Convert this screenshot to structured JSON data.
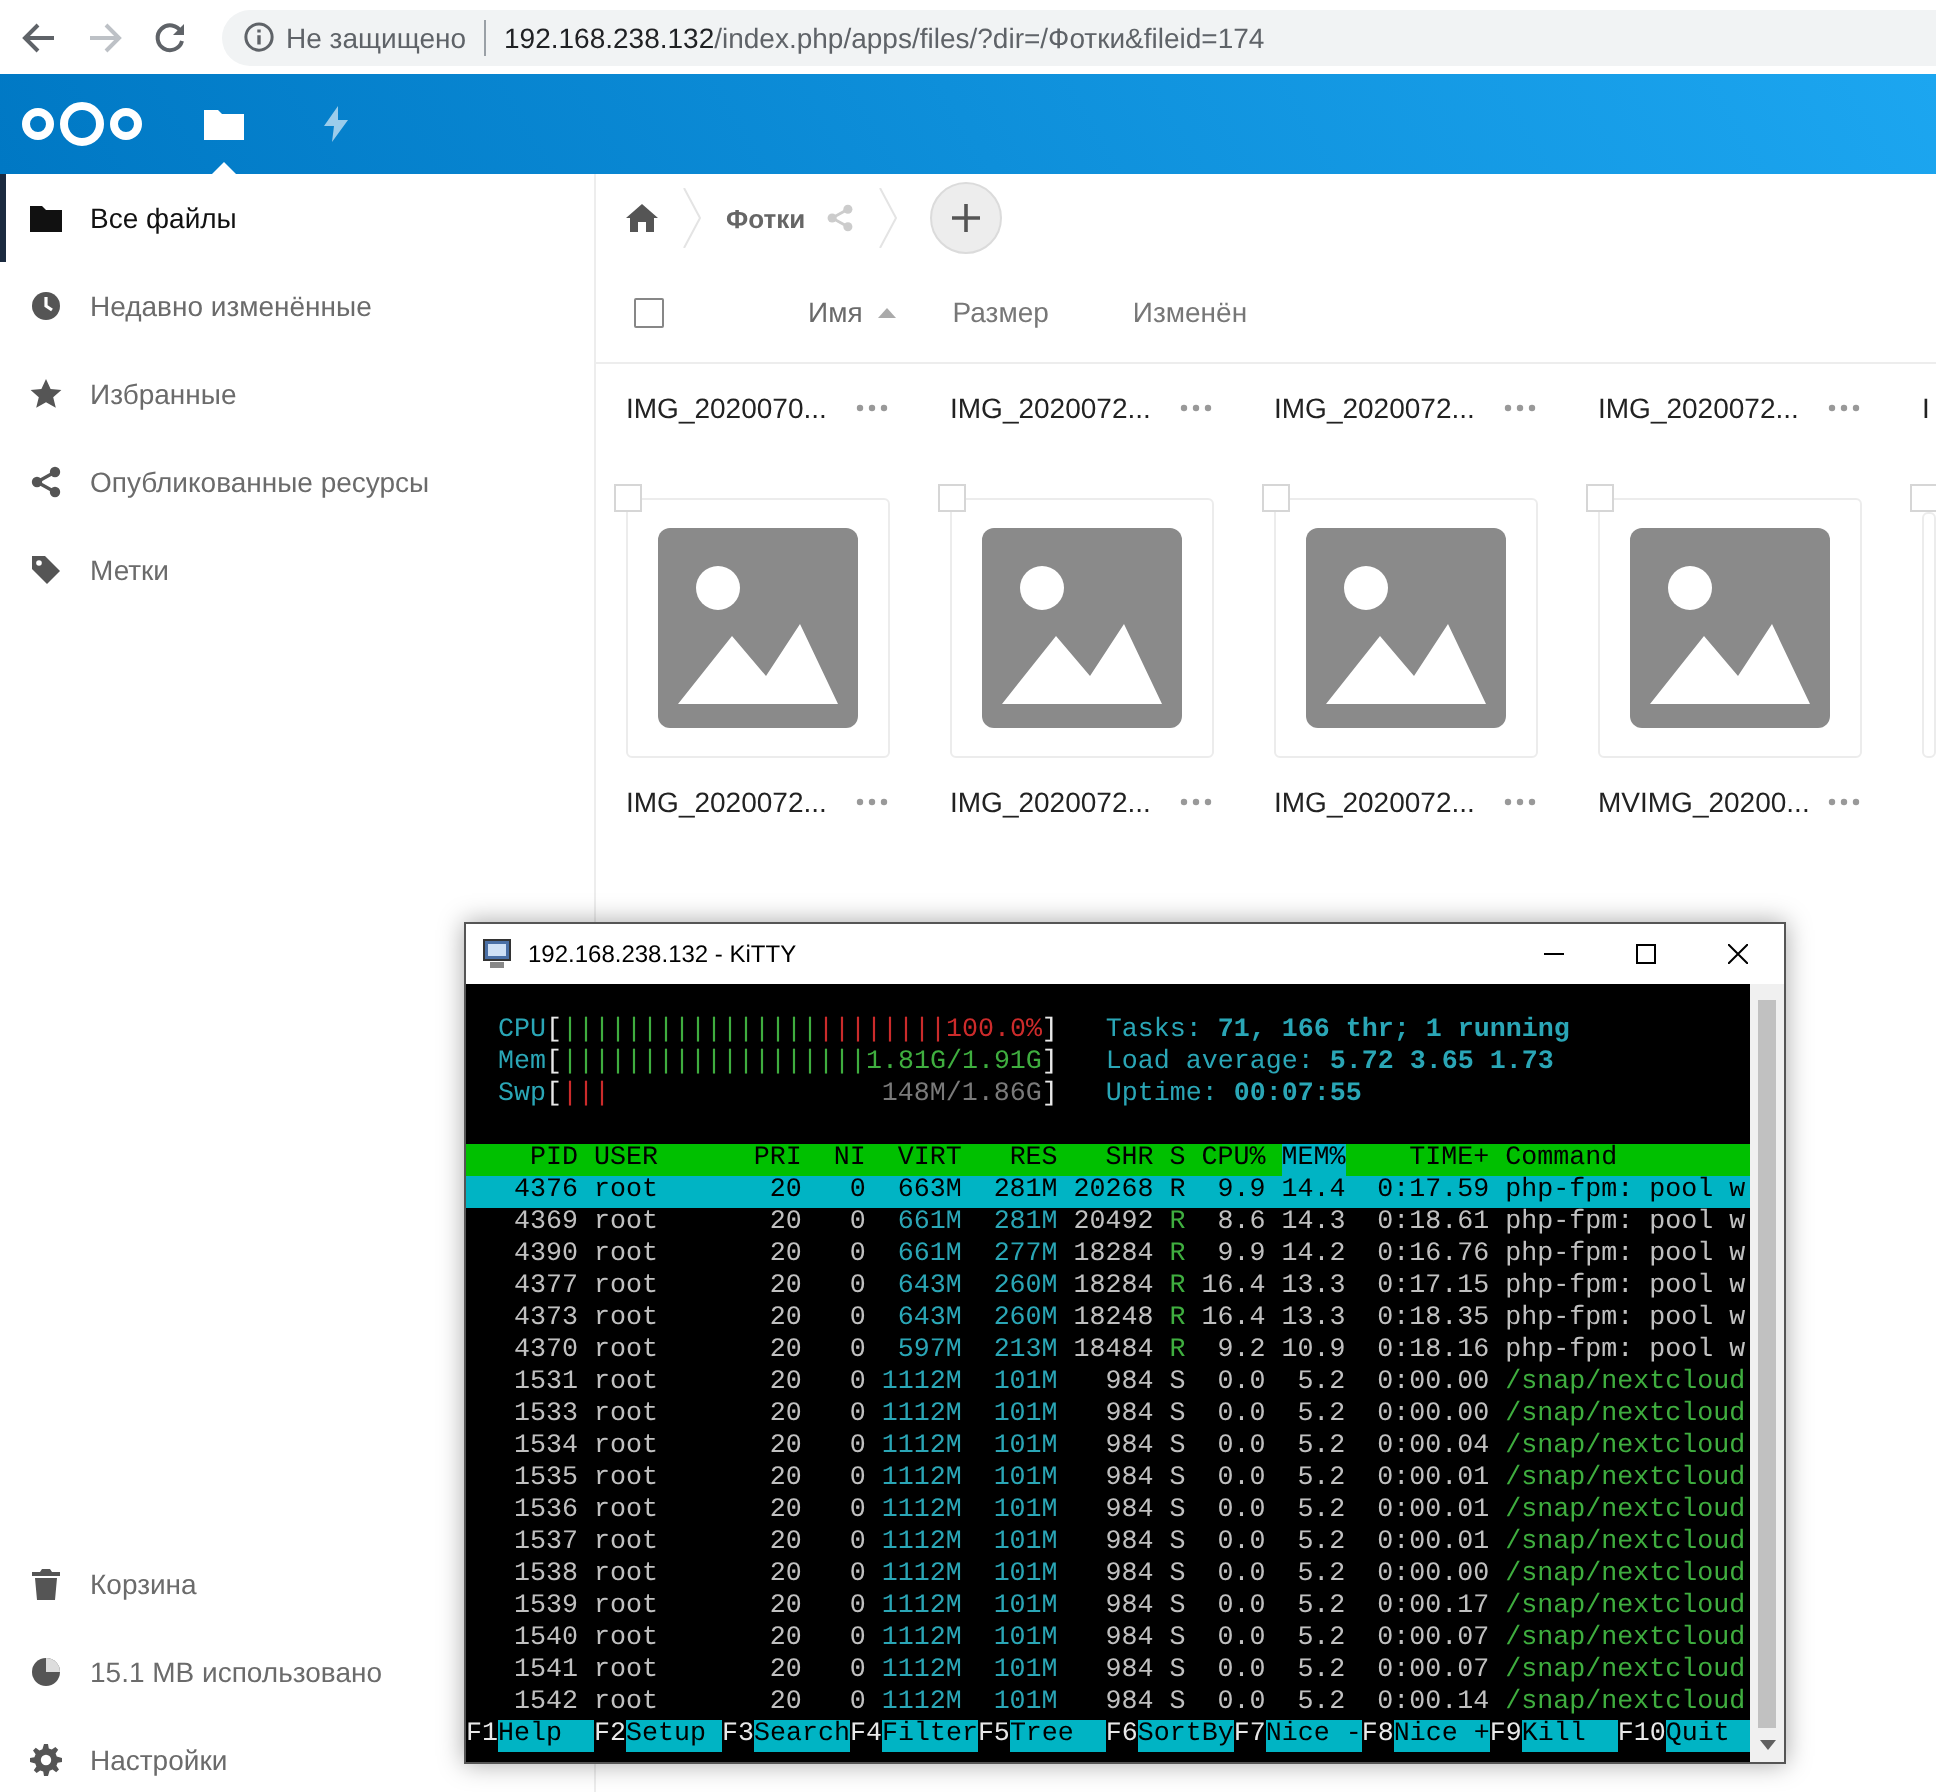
{
  "browser": {
    "forward_disabled": true,
    "security": "Не защищено",
    "url_host": "192.168.238.132",
    "url_path": "/index.php/apps/files/?dir=/Фотки&fileid=174"
  },
  "header": {
    "apps": [
      {
        "kind": "files",
        "selected": true
      },
      {
        "kind": "activity",
        "selected": false
      }
    ]
  },
  "sidebar": {
    "items": [
      {
        "kind": "folder",
        "label": "Все файлы",
        "selected": true
      },
      {
        "kind": "clock",
        "label": "Недавно изменённые",
        "selected": false
      },
      {
        "kind": "star",
        "label": "Избранные",
        "selected": false
      },
      {
        "kind": "share",
        "label": "Опубликованные ресурсы",
        "selected": false
      },
      {
        "kind": "tag",
        "label": "Метки",
        "selected": false
      }
    ],
    "footer": [
      {
        "kind": "trash",
        "label": "Корзина"
      },
      {
        "kind": "pie",
        "label": "15.1 MB использовано"
      },
      {
        "kind": "gear",
        "label": "Настройки"
      }
    ]
  },
  "breadcrumb": {
    "folder": "Фотки"
  },
  "select_all": {
    "checked": false
  },
  "columns": [
    {
      "label": "Имя",
      "sorted": true
    },
    {
      "label": "Размер",
      "sorted": false
    },
    {
      "label": "Изменён",
      "sorted": false
    }
  ],
  "grid": [
    {
      "kind": "names",
      "files": [
        {
          "name": "IMG_2020070..."
        },
        {
          "name": "IMG_2020072..."
        },
        {
          "name": "IMG_2020072..."
        },
        {
          "name": "IMG_2020072..."
        },
        {
          "name": "I"
        }
      ]
    },
    {
      "kind": "thumbnails",
      "files": [
        {
          "name": "IMG_2020072...",
          "checked": false
        },
        {
          "name": "IMG_2020072...",
          "checked": false
        },
        {
          "name": "IMG_2020072...",
          "checked": false
        },
        {
          "name": "MVIMG_20200...",
          "checked": false
        },
        {
          "checked": false
        }
      ]
    }
  ],
  "terminal": {
    "title": "192.168.238.132 - KiTTY",
    "meters": [
      {
        "label": "CPU",
        "open": "[",
        "bars": [
          {
            "text": "||||||||||||||||",
            "color": "#3fae3f"
          },
          {
            "text": "||||||||",
            "color": "#cc2b2b"
          }
        ],
        "value": {
          "text": "100.0%",
          "color": "#cc2b2b"
        },
        "close": "]"
      },
      {
        "label": "Mem",
        "open": "[",
        "bars": [
          {
            "text": "|||||||||||||||||||",
            "color": "#3fae3f"
          }
        ],
        "value": {
          "text": "1.81G/1.91G",
          "color": "#3fae3f"
        },
        "close": "]"
      },
      {
        "label": "Swp",
        "open": "[",
        "bars": [
          {
            "text": "|||",
            "color": "#cc2b2b"
          }
        ],
        "value": {
          "text": "148M/1.86G",
          "color": "#7a7a7a"
        },
        "close": "]"
      }
    ],
    "summary": [
      {
        "label": "Tasks:",
        "value": "71, 166 thr; 1 running"
      },
      {
        "label": "Load average:",
        "value": "5.72 3.65 1.73"
      },
      {
        "label": "Uptime:",
        "value": "00:07:55"
      }
    ],
    "columns": [
      {
        "label": "PID",
        "sorted": false
      },
      {
        "label": "USER",
        "sorted": false
      },
      {
        "label": "PRI",
        "sorted": false
      },
      {
        "label": "NI",
        "sorted": false
      },
      {
        "label": "VIRT",
        "sorted": false
      },
      {
        "label": "RES",
        "sorted": false
      },
      {
        "label": "SHR",
        "sorted": false
      },
      {
        "label": "S",
        "sorted": false
      },
      {
        "label": "CPU%",
        "sorted": false
      },
      {
        "label": "MEM%",
        "sorted": true
      },
      {
        "label": "TIME+",
        "sorted": false
      },
      {
        "label": "Command",
        "sorted": false
      }
    ],
    "processes": [
      {
        "pid": "4376",
        "user": "root",
        "pri": "20",
        "ni": "0",
        "virt": "663M",
        "res": "281M",
        "shr": "20268",
        "state": "R",
        "cpu": "9.9",
        "mem": "14.4",
        "time": "0:17.59",
        "command": "php-fpm: pool w",
        "running": true,
        "thread": false,
        "selected": true
      },
      {
        "pid": "4369",
        "user": "root",
        "pri": "20",
        "ni": "0",
        "virt": "661M",
        "res": "281M",
        "shr": "20492",
        "state": "R",
        "cpu": "8.6",
        "mem": "14.3",
        "time": "0:18.61",
        "command": "php-fpm: pool w",
        "running": true,
        "thread": false,
        "selected": false
      },
      {
        "pid": "4390",
        "user": "root",
        "pri": "20",
        "ni": "0",
        "virt": "661M",
        "res": "277M",
        "shr": "18284",
        "state": "R",
        "cpu": "9.9",
        "mem": "14.2",
        "time": "0:16.76",
        "command": "php-fpm: pool w",
        "running": true,
        "thread": false,
        "selected": false
      },
      {
        "pid": "4377",
        "user": "root",
        "pri": "20",
        "ni": "0",
        "virt": "643M",
        "res": "260M",
        "shr": "18284",
        "state": "R",
        "cpu": "16.4",
        "mem": "13.3",
        "time": "0:17.15",
        "command": "php-fpm: pool w",
        "running": true,
        "thread": false,
        "selected": false
      },
      {
        "pid": "4373",
        "user": "root",
        "pri": "20",
        "ni": "0",
        "virt": "643M",
        "res": "260M",
        "shr": "18248",
        "state": "R",
        "cpu": "16.4",
        "mem": "13.3",
        "time": "0:18.35",
        "command": "php-fpm: pool w",
        "running": true,
        "thread": false,
        "selected": false
      },
      {
        "pid": "4370",
        "user": "root",
        "pri": "20",
        "ni": "0",
        "virt": "597M",
        "res": "213M",
        "shr": "18484",
        "state": "R",
        "cpu": "9.2",
        "mem": "10.9",
        "time": "0:18.16",
        "command": "php-fpm: pool w",
        "running": true,
        "thread": false,
        "selected": false
      },
      {
        "pid": "1531",
        "user": "root",
        "pri": "20",
        "ni": "0",
        "virt": "1112M",
        "res": "101M",
        "shr": "984",
        "state": "S",
        "cpu": "0.0",
        "mem": "5.2",
        "time": "0:00.00",
        "command": "/snap/nextcloud",
        "running": false,
        "thread": true,
        "selected": false
      },
      {
        "pid": "1533",
        "user": "root",
        "pri": "20",
        "ni": "0",
        "virt": "1112M",
        "res": "101M",
        "shr": "984",
        "state": "S",
        "cpu": "0.0",
        "mem": "5.2",
        "time": "0:00.00",
        "command": "/snap/nextcloud",
        "running": false,
        "thread": true,
        "selected": false
      },
      {
        "pid": "1534",
        "user": "root",
        "pri": "20",
        "ni": "0",
        "virt": "1112M",
        "res": "101M",
        "shr": "984",
        "state": "S",
        "cpu": "0.0",
        "mem": "5.2",
        "time": "0:00.04",
        "command": "/snap/nextcloud",
        "running": false,
        "thread": true,
        "selected": false
      },
      {
        "pid": "1535",
        "user": "root",
        "pri": "20",
        "ni": "0",
        "virt": "1112M",
        "res": "101M",
        "shr": "984",
        "state": "S",
        "cpu": "0.0",
        "mem": "5.2",
        "time": "0:00.01",
        "command": "/snap/nextcloud",
        "running": false,
        "thread": true,
        "selected": false
      },
      {
        "pid": "1536",
        "user": "root",
        "pri": "20",
        "ni": "0",
        "virt": "1112M",
        "res": "101M",
        "shr": "984",
        "state": "S",
        "cpu": "0.0",
        "mem": "5.2",
        "time": "0:00.01",
        "command": "/snap/nextcloud",
        "running": false,
        "thread": true,
        "selected": false
      },
      {
        "pid": "1537",
        "user": "root",
        "pri": "20",
        "ni": "0",
        "virt": "1112M",
        "res": "101M",
        "shr": "984",
        "state": "S",
        "cpu": "0.0",
        "mem": "5.2",
        "time": "0:00.01",
        "command": "/snap/nextcloud",
        "running": false,
        "thread": true,
        "selected": false
      },
      {
        "pid": "1538",
        "user": "root",
        "pri": "20",
        "ni": "0",
        "virt": "1112M",
        "res": "101M",
        "shr": "984",
        "state": "S",
        "cpu": "0.0",
        "mem": "5.2",
        "time": "0:00.00",
        "command": "/snap/nextcloud",
        "running": false,
        "thread": true,
        "selected": false
      },
      {
        "pid": "1539",
        "user": "root",
        "pri": "20",
        "ni": "0",
        "virt": "1112M",
        "res": "101M",
        "shr": "984",
        "state": "S",
        "cpu": "0.0",
        "mem": "5.2",
        "time": "0:00.17",
        "command": "/snap/nextcloud",
        "running": false,
        "thread": true,
        "selected": false
      },
      {
        "pid": "1540",
        "user": "root",
        "pri": "20",
        "ni": "0",
        "virt": "1112M",
        "res": "101M",
        "shr": "984",
        "state": "S",
        "cpu": "0.0",
        "mem": "5.2",
        "time": "0:00.07",
        "command": "/snap/nextcloud",
        "running": false,
        "thread": true,
        "selected": false
      },
      {
        "pid": "1541",
        "user": "root",
        "pri": "20",
        "ni": "0",
        "virt": "1112M",
        "res": "101M",
        "shr": "984",
        "state": "S",
        "cpu": "0.0",
        "mem": "5.2",
        "time": "0:00.07",
        "command": "/snap/nextcloud",
        "running": false,
        "thread": true,
        "selected": false
      },
      {
        "pid": "1542",
        "user": "root",
        "pri": "20",
        "ni": "0",
        "virt": "1112M",
        "res": "101M",
        "shr": "984",
        "state": "S",
        "cpu": "0.0",
        "mem": "5.2",
        "time": "0:00.14",
        "command": "/snap/nextcloud",
        "running": false,
        "thread": true,
        "selected": false
      }
    ],
    "function_keys": [
      {
        "key": "F1",
        "label": "Help"
      },
      {
        "key": "F2",
        "label": "Setup"
      },
      {
        "key": "F3",
        "label": "Search"
      },
      {
        "key": "F4",
        "label": "Filter"
      },
      {
        "key": "F5",
        "label": "Tree"
      },
      {
        "key": "F6",
        "label": "SortBy"
      },
      {
        "key": "F7",
        "label": "Nice -"
      },
      {
        "key": "F8",
        "label": "Nice +"
      },
      {
        "key": "F9",
        "label": "Kill"
      },
      {
        "key": "F10",
        "label": "Quit"
      }
    ]
  }
}
